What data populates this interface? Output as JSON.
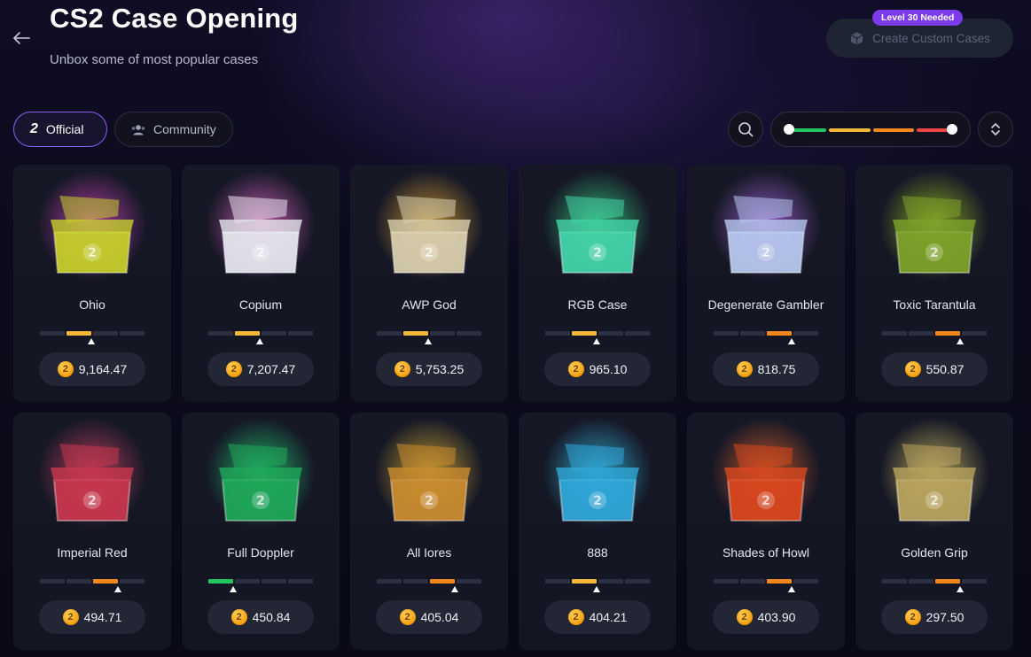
{
  "header": {
    "title": "CS2 Case Opening",
    "subtitle": "Unbox some of most popular cases",
    "back_icon": "arrow-left-icon"
  },
  "create": {
    "badge": "Level 30 Needed",
    "label": "Create Custom Cases",
    "icon": "case-box-icon"
  },
  "tabs": [
    {
      "label": "Official",
      "icon": "brand-2-icon",
      "active": true
    },
    {
      "label": "Community",
      "icon": "users-icon",
      "active": false
    }
  ],
  "filters": {
    "search_icon": "search-icon",
    "sort_icon": "sort-updown-icon",
    "risk_range": {
      "min": 0,
      "max": 1
    },
    "colors": {
      "green": "#22c55e",
      "yellow": "#f4b73a",
      "orange": "#f7861c",
      "red": "#ef4444"
    }
  },
  "currency_symbol": "2",
  "cases": [
    {
      "name": "Ohio",
      "price": "9,164.47",
      "risk_level": 2,
      "color": "#f4b73a",
      "art_color": "#c6cf2a",
      "art_glow": "#e24acb"
    },
    {
      "name": "Copium",
      "price": "7,207.47",
      "risk_level": 2,
      "color": "#f4b73a",
      "art_color": "#e6e6ee",
      "art_glow": "#f26bd0"
    },
    {
      "name": "AWP God",
      "price": "5,753.25",
      "risk_level": 2,
      "color": "#f4b73a",
      "art_color": "#d8cfae",
      "art_glow": "#f2b235"
    },
    {
      "name": "RGB Case",
      "price": "965.10",
      "risk_level": 2,
      "color": "#f4b73a",
      "art_color": "#43d3a8",
      "art_glow": "#3be08a"
    },
    {
      "name": "Degenerate Gambler",
      "price": "818.75",
      "risk_level": 3,
      "color": "#f7861c",
      "art_color": "#b6c7ee",
      "art_glow": "#b46ef0"
    },
    {
      "name": "Toxic Tarantula",
      "price": "550.87",
      "risk_level": 3,
      "color": "#f7861c",
      "art_color": "#7da12a",
      "art_glow": "#a6d322"
    },
    {
      "name": "Imperial Red",
      "price": "494.71",
      "risk_level": 3,
      "color": "#f7861c",
      "art_color": "#c8374e",
      "art_glow": "#e0476a"
    },
    {
      "name": "Full Doppler",
      "price": "450.84",
      "risk_level": 1,
      "color": "#22c55e",
      "art_color": "#1fa85a",
      "art_glow": "#22e07a"
    },
    {
      "name": "All Iores",
      "price": "405.04",
      "risk_level": 3,
      "color": "#f7861c",
      "art_color": "#c98b2e",
      "art_glow": "#f1c136"
    },
    {
      "name": "888",
      "price": "404.21",
      "risk_level": 2,
      "color": "#f4b73a",
      "art_color": "#2fa7d8",
      "art_glow": "#36c8f2"
    },
    {
      "name": "Shades of Howl",
      "price": "403.90",
      "risk_level": 3,
      "color": "#f7861c",
      "art_color": "#d9471f",
      "art_glow": "#f26a25"
    },
    {
      "name": "Golden Grip",
      "price": "297.50",
      "risk_level": 3,
      "color": "#f7861c",
      "art_color": "#b8a35e",
      "art_glow": "#e5cf6a"
    }
  ]
}
